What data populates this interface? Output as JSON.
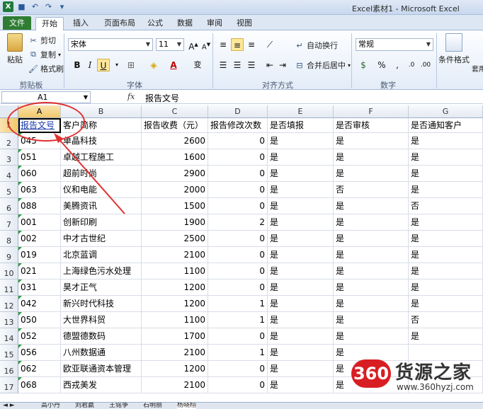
{
  "window": {
    "title": "Excel素材1 - Microsoft Excel"
  },
  "tabs": [
    "文件",
    "开始",
    "插入",
    "页面布局",
    "公式",
    "数据",
    "审阅",
    "视图"
  ],
  "ribbon": {
    "paste": "粘贴",
    "cut": "剪切",
    "copy": "复制",
    "format_painter": "格式刷",
    "clipboard_label": "剪贴板",
    "font_name": "宋体",
    "font_size": "11",
    "font_label": "字体",
    "wrap_text": "自动换行",
    "merge_center": "合并后居中",
    "alignment_label": "对齐方式",
    "number_format": "常规",
    "number_label": "数字",
    "cond_format": "条件格式",
    "table_format": "套用表格"
  },
  "formula_bar": {
    "name_box": "A1",
    "fx": "fx",
    "content": "报告文号"
  },
  "columns": [
    "A",
    "B",
    "C",
    "D",
    "E",
    "F",
    "G"
  ],
  "headers": [
    "报告文号",
    "客户简称",
    "报告收费（元）",
    "报告修改次数",
    "是否填报",
    "是否审核",
    "是否通知客户"
  ],
  "rows": [
    {
      "n": "2",
      "cells": [
        "045",
        "单晶科技",
        "2600",
        "0",
        "是",
        "是",
        "是"
      ]
    },
    {
      "n": "3",
      "cells": [
        "051",
        "卓越工程施工",
        "1600",
        "0",
        "是",
        "是",
        "是"
      ]
    },
    {
      "n": "4",
      "cells": [
        "060",
        "超前时尚",
        "2900",
        "0",
        "是",
        "是",
        "是"
      ]
    },
    {
      "n": "5",
      "cells": [
        "063",
        "仪和电能",
        "2000",
        "0",
        "是",
        "否",
        "是"
      ]
    },
    {
      "n": "6",
      "cells": [
        "088",
        "美腾资讯",
        "1500",
        "0",
        "是",
        "是",
        "否"
      ]
    },
    {
      "n": "7",
      "cells": [
        "001",
        "创新印刷",
        "1900",
        "2",
        "是",
        "是",
        "是"
      ]
    },
    {
      "n": "8",
      "cells": [
        "002",
        "中才古世纪",
        "2500",
        "0",
        "是",
        "是",
        "是"
      ]
    },
    {
      "n": "9",
      "cells": [
        "019",
        "北京蓝调",
        "2100",
        "0",
        "是",
        "是",
        "是"
      ]
    },
    {
      "n": "10",
      "cells": [
        "021",
        "上海绿色污水处理",
        "1100",
        "0",
        "是",
        "是",
        "是"
      ]
    },
    {
      "n": "11",
      "cells": [
        "031",
        "昊才正气",
        "1200",
        "0",
        "是",
        "是",
        "是"
      ]
    },
    {
      "n": "12",
      "cells": [
        "042",
        "新兴时代科技",
        "1200",
        "1",
        "是",
        "是",
        "是"
      ]
    },
    {
      "n": "13",
      "cells": [
        "050",
        "大世界科贸",
        "1100",
        "1",
        "是",
        "是",
        "否"
      ]
    },
    {
      "n": "14",
      "cells": [
        "052",
        "德盟德数码",
        "1700",
        "0",
        "是",
        "是",
        "是"
      ]
    },
    {
      "n": "15",
      "cells": [
        "056",
        "八州数据通",
        "2100",
        "1",
        "是",
        "是",
        ""
      ]
    },
    {
      "n": "16",
      "cells": [
        "062",
        "欧亚联通资本管理",
        "1200",
        "0",
        "是",
        "是",
        ""
      ]
    },
    {
      "n": "17",
      "cells": [
        "068",
        "西戎美发",
        "2100",
        "0",
        "是",
        "是",
        ""
      ]
    }
  ],
  "sheet_tabs": [
    "高小丹",
    "刘君嬴",
    "王铭争",
    "石明丽",
    "杨晓栩"
  ],
  "watermark": {
    "badge": "360",
    "name": "货源之家",
    "url": "www.360hyzj.com"
  }
}
